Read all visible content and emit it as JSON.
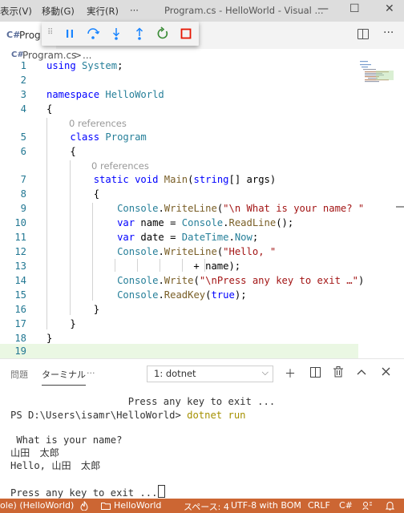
{
  "titlebar": {
    "menu": [
      "表示(V)",
      "移動(G)",
      "実行(R)",
      "···"
    ],
    "window_title": "Program.cs - HelloWorld - Visual ...",
    "controls": {
      "minimize": "—",
      "maximize": "☐",
      "close": "✕"
    }
  },
  "tabs": {
    "active_label": "Prog",
    "active_icon": "C#"
  },
  "debug_toolbar": {
    "buttons": [
      "pause",
      "step-over",
      "step-into",
      "step-out",
      "restart",
      "stop"
    ],
    "colors": {
      "blue": "#1a85ff",
      "green": "#388a34",
      "red": "#e51400"
    }
  },
  "breadcrumb": {
    "file": "Program.cs",
    "separator": ">",
    "more": "..."
  },
  "editor": {
    "codelens": "0 references",
    "lines": [
      "1",
      "2",
      "3",
      "4",
      "5",
      "6",
      "7",
      "8",
      "9",
      "10",
      "11",
      "12",
      "13",
      "14",
      "15",
      "16",
      "17",
      "18",
      "19"
    ]
  },
  "panel": {
    "tabs": [
      "問題",
      "ターミナル",
      "···"
    ],
    "terminal_select": "1: dotnet",
    "icons": [
      "plus-icon",
      "split-icon",
      "trash-icon",
      "chevron-up-icon",
      "chevron-down-icon"
    ],
    "terminal": {
      "line1": "                    Press any key to exit ...",
      "prompt": "PS D:\\Users\\isamr\\HelloWorld> ",
      "command": "dotnet run",
      "blank": "",
      "question": " What is your name?",
      "input": "山田　太郎",
      "greeting": "Hello, 山田　太郎",
      "blank2": "",
      "exit": "Press any key to exit ..."
    }
  },
  "statusbar": {
    "debug": "ole) (HelloWorld)",
    "project": "HelloWorld",
    "spaces": "スペース: 4",
    "encoding": "UTF-8 with BOM",
    "eol": "CRLF",
    "language": "C#",
    "bg_color": "#cc6633"
  }
}
